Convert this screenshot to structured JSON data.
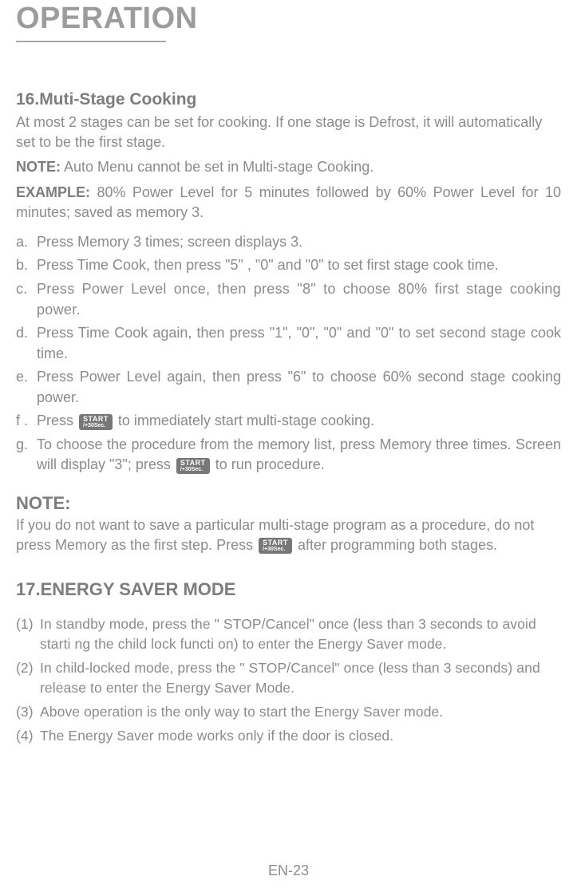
{
  "title": "OPERATION",
  "section16": {
    "heading": "16.Muti-Stage Cooking",
    "intro": "At most 2 stages can be set for cooking. If one stage is Defrost, it will automatically set to  be the first stage.",
    "noteLabel": "NOTE:",
    "noteText": " Auto Menu cannot be set in Multi-stage Cooking.",
    "exampleLabel": "EXAMPLE:",
    "exampleText": " 80% Power Level for 5 minutes followed by 60% Power Level for 10 minutes;  saved as memory 3.",
    "steps": {
      "a": {
        "m": "a.",
        "t": "Press Memory 3 times; screen displays 3."
      },
      "b": {
        "m": "b.",
        "t": "Press Time Cook, then press \"5\" , \"0\" and \"0\" to set first stage cook time."
      },
      "c": {
        "m": "c.",
        "t": "Press Power Level once, then press \"8\" to choose 80% first stage cooking power."
      },
      "d": {
        "m": "d.",
        "t": "Press Time Cook again, then press \"1\", \"0\", \"0\" and \"0\" to set second stage cook time."
      },
      "e": {
        "m": "e.",
        "t": "Press Power Level again, then press \"6\" to choose 60% second stage cooking power."
      },
      "f": {
        "m": "f .",
        "pre": "Press ",
        "post": " to immediately start multi-stage cooking."
      },
      "g": {
        "m": "g.",
        "pre": "To choose the procedure from the memory list, press Memory three times. Screen will  display \"3\"; press ",
        "post": "  to run procedure."
      }
    }
  },
  "noteBlock": {
    "heading": "NOTE:",
    "pre": "If you do not want to save a particular multi-stage program as a procedure, do not press Memory as the first step. Press    ",
    "post": "  after programming both stages."
  },
  "section17": {
    "heading": "17.ENERGY SAVER MODE",
    "items": {
      "1": {
        "m": "(1)",
        "t": "In standby mode, press the \" STOP/Cancel\"  once (less than 3 seconds to avoid starti ng the child lock  functi on) to enter the Energy Saver mode."
      },
      "2": {
        "m": "(2)",
        "t": "In child-locked mode, press the \" STOP/Cancel\"  once (less than 3 seconds) and release to enter the Energy Saver Mode."
      },
      "3": {
        "m": "(3)",
        "t": "Above operation is the only way to start the Energy Saver mode."
      },
      "4": {
        "m": "(4)",
        "t": "The Energy Saver mode works only if the door is closed."
      }
    }
  },
  "startBtn": {
    "line1": "START",
    "line2": "/+30Sec."
  },
  "pageNum": "EN-23"
}
